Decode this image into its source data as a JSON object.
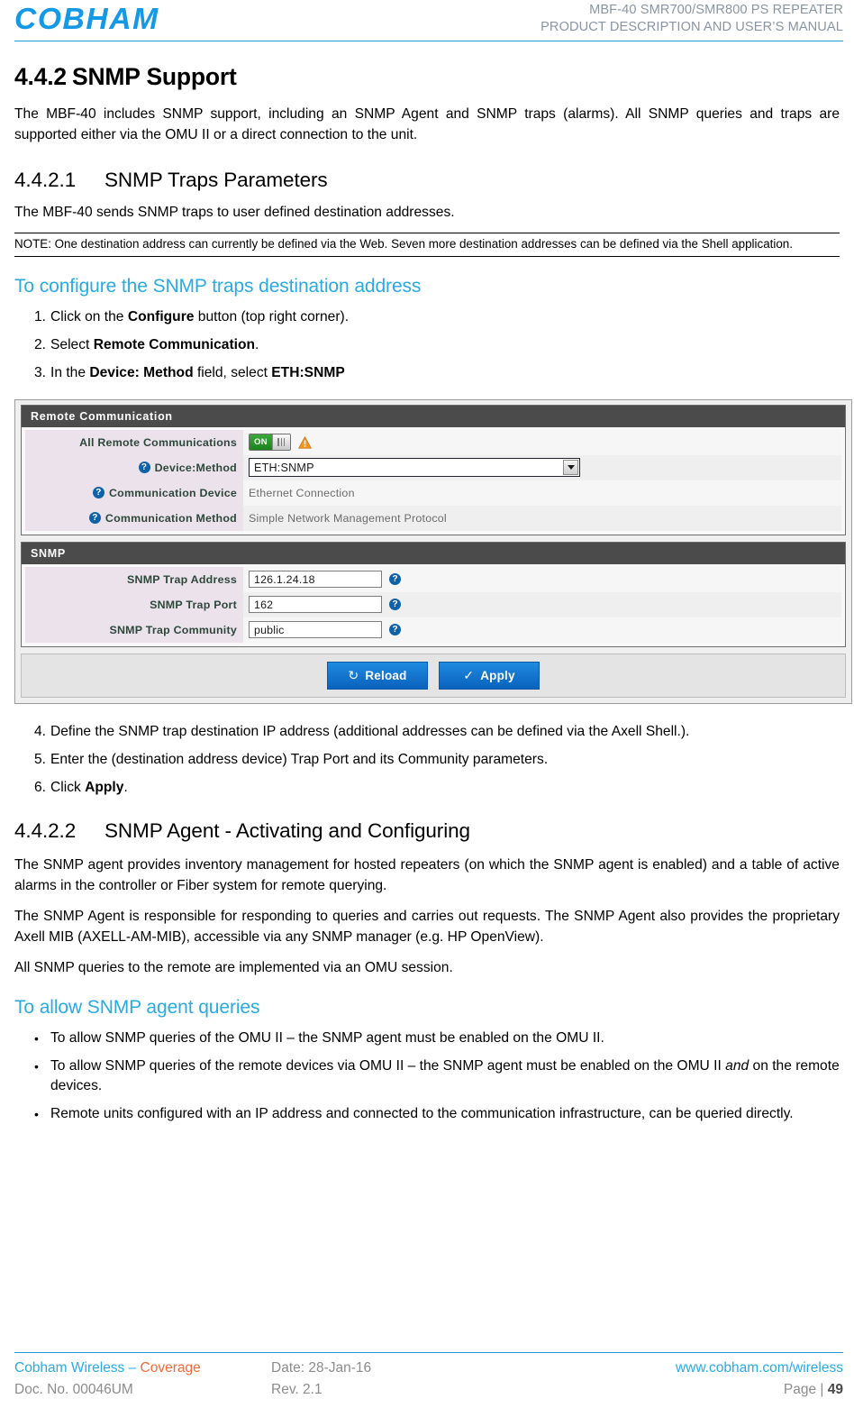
{
  "header": {
    "logo_text": "COBHAM",
    "line1": "MBF-40 SMR700/SMR800 PS REPEATER",
    "line2": "PRODUCT DESCRIPTION AND USER’S MANUAL",
    "accent_color": "#1399E5",
    "rule_color": "#2A9BD8"
  },
  "section_442": {
    "number": "4.4.2",
    "title": "SNMP Support",
    "paragraph": "The MBF-40 includes SNMP support, including an SNMP Agent and SNMP traps (alarms). All SNMP queries and traps are supported either via the OMU II or a direct connection to the unit."
  },
  "section_4421": {
    "number": "4.4.2.1",
    "title": "SNMP Traps Parameters",
    "paragraph": "The MBF-40 sends SNMP traps to user defined destination addresses.",
    "note": "NOTE: One destination address can currently be defined via the Web. Seven more destination addresses can be defined via the Shell application."
  },
  "procedure_1": {
    "heading": "To configure the SNMP traps destination address",
    "heading_color": "#29ABE2",
    "steps": [
      {
        "marker": "1.",
        "pre": "Click on the ",
        "bold": "Configure",
        "post": " button (top right corner)."
      },
      {
        "marker": "2.",
        "pre": "Select ",
        "bold": "Remote Communication",
        "post": "."
      },
      {
        "marker": "3.",
        "pre": "In the ",
        "bold": "Device: Method",
        "post": " field, select ",
        "bold2": "ETH:SNMP"
      }
    ]
  },
  "screenshot": {
    "remote_communication": {
      "title": "Remote Communication",
      "rows": [
        {
          "label": "All Remote Communications",
          "type": "toggle",
          "toggle_label": "ON",
          "has_help": false,
          "has_warning": true
        },
        {
          "label": "Device:Method",
          "type": "select",
          "value": "ETH:SNMP",
          "has_help": true
        },
        {
          "label": "Communication Device",
          "type": "text",
          "value": "Ethernet Connection",
          "has_help": true
        },
        {
          "label": "Communication Method",
          "type": "text",
          "value": "Simple Network Management Protocol",
          "has_help": true
        }
      ]
    },
    "snmp": {
      "title": "SNMP",
      "rows": [
        {
          "label": "SNMP Trap Address",
          "type": "input",
          "value": "126.1.24.18",
          "has_help": true
        },
        {
          "label": "SNMP Trap Port",
          "type": "input",
          "value": "162",
          "has_help": true
        },
        {
          "label": "SNMP Trap Community",
          "type": "input",
          "value": "public",
          "has_help": true
        }
      ]
    },
    "buttons": {
      "reload_label": "Reload",
      "reload_icon": "refresh-icon",
      "apply_label": "Apply",
      "apply_icon": "checkmark-icon"
    }
  },
  "procedure_1_cont": {
    "steps": [
      {
        "marker": "4.",
        "text": "Define the SNMP trap destination IP address (additional addresses can be defined via the Axell Shell.)."
      },
      {
        "marker": "5.",
        "text": "Enter the (destination address device) Trap Port and its Community parameters."
      },
      {
        "marker": "6.",
        "pre": "Click ",
        "bold": "Apply",
        "post": "."
      }
    ]
  },
  "section_4422": {
    "number": "4.4.2.2",
    "title": "SNMP Agent - Activating and Configuring",
    "paragraph1": "The SNMP agent provides inventory management for hosted repeaters (on which the SNMP agent is enabled) and a table of active alarms in the controller or Fiber system for remote querying.",
    "paragraph2": "The SNMP Agent is responsible for responding to queries and carries out requests. The SNMP Agent also provides the proprietary Axell MIB (AXELL-AM-MIB), accessible via any SNMP manager (e.g. HP OpenView).",
    "paragraph3": "All SNMP queries to the remote are implemented via an OMU session."
  },
  "procedure_2": {
    "heading": "To allow SNMP agent queries",
    "bullets": [
      {
        "marker": "•",
        "text": "To allow SNMP queries of the OMU II – the SNMP agent must be enabled on the OMU II."
      },
      {
        "marker": "•",
        "pre": "To allow SNMP queries of the remote devices via OMU II – the SNMP agent must be enabled on the OMU II ",
        "italic": "and",
        "post": " on the remote devices."
      },
      {
        "marker": "•",
        "text": "Remote units configured with an IP address and connected to the communication infrastructure, can be queried directly."
      }
    ]
  },
  "footer": {
    "company": "Cobham Wireless",
    "dash": " – ",
    "division": "Coverage",
    "date": "Date: 28-Jan-16",
    "website": "www.cobham.com/wireless",
    "doc_no": "Doc. No. 00046UM",
    "revision": "Rev. 2.1",
    "page_label": "Page | ",
    "page_number": "49",
    "blue": "#29ABE2",
    "orange": "#F26A36"
  }
}
